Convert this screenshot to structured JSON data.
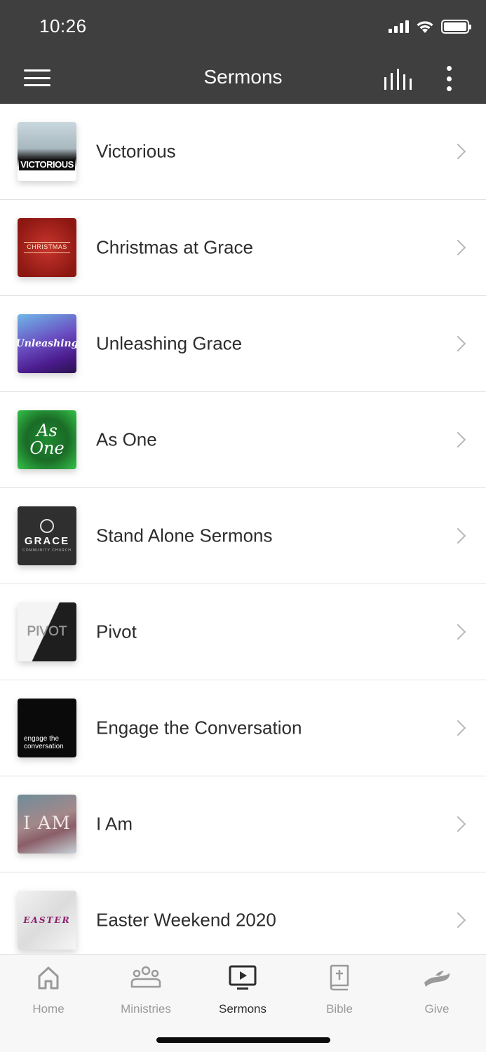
{
  "status_bar": {
    "time": "10:26",
    "signal_icon": "cellular-signal-icon",
    "wifi_icon": "wifi-icon",
    "battery_icon": "battery-icon"
  },
  "header": {
    "title": "Sermons",
    "menu_icon": "hamburger-menu-icon",
    "audio_icon": "audio-levels-icon",
    "more_icon": "more-vertical-icon",
    "background_color": "#3f3f3f"
  },
  "sermons": [
    {
      "title": "Victorious",
      "thumb_text": "VICTORIOUS"
    },
    {
      "title": "Christmas at Grace",
      "thumb_text": "CHRISTMAS"
    },
    {
      "title": "Unleashing Grace",
      "thumb_text": "Unleashing"
    },
    {
      "title": "As One",
      "thumb_text": "As One"
    },
    {
      "title": "Stand Alone Sermons",
      "thumb_text": "GRACE",
      "thumb_subtext": "COMMUNITY CHURCH"
    },
    {
      "title": "Pivot",
      "thumb_text": "PIVOT"
    },
    {
      "title": "Engage the Conversation",
      "thumb_text": "engage the conversation"
    },
    {
      "title": "I Am",
      "thumb_text": "I AM"
    },
    {
      "title": "Easter Weekend 2020",
      "thumb_text": "EASTER"
    }
  ],
  "tabs": [
    {
      "label": "Home",
      "icon": "home-icon",
      "active": false
    },
    {
      "label": "Ministries",
      "icon": "people-group-icon",
      "active": false
    },
    {
      "label": "Sermons",
      "icon": "video-play-icon",
      "active": true
    },
    {
      "label": "Bible",
      "icon": "bible-book-icon",
      "active": false
    },
    {
      "label": "Give",
      "icon": "giving-hand-icon",
      "active": false
    }
  ]
}
